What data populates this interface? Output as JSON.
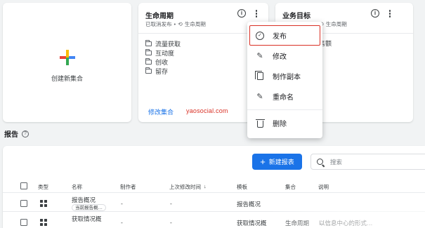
{
  "new_collection": {
    "label": "创建新集合"
  },
  "lifecycle_card": {
    "title": "生命周期",
    "status": "已取消发布",
    "separator": "•",
    "sync_label": "生命周期",
    "items": [
      "流量获取",
      "互动度",
      "创收",
      "留存"
    ],
    "edit_link": "修改集合"
  },
  "business_card": {
    "title": "业务目标",
    "sync_label": "生命周期",
    "visible_item": "售额"
  },
  "context_menu": {
    "items": [
      {
        "label": "发布",
        "icon": "check-circle-icon",
        "selected": true
      },
      {
        "label": "修改",
        "icon": "pencil-icon"
      },
      {
        "label": "制作副本",
        "icon": "copy-icon"
      },
      {
        "label": "重命名",
        "icon": "pencil-icon"
      },
      {
        "label": "删除",
        "icon": "trash-icon"
      }
    ]
  },
  "watermark": "yaosocial.com",
  "reports_section": {
    "title": "报告",
    "new_report_label": "新建报表",
    "search_placeholder": "搜索",
    "columns": {
      "type": "类型",
      "name": "名称",
      "creator": "制作者",
      "modified": "上次修改时间",
      "sort_arrow": "↓",
      "template": "模板",
      "collection": "集合",
      "description": "说明"
    },
    "rows": [
      {
        "name": "报告概况",
        "chip": "当前报告概…",
        "creator": "-",
        "modified": "-",
        "template": "报告概况",
        "collection": "",
        "description": ""
      },
      {
        "name": "获取情况概",
        "chip": "",
        "creator": "-",
        "modified": "-",
        "template": "获取情况概",
        "collection": "生命周期",
        "description": "以信息中心的形式…"
      }
    ]
  },
  "colors": {
    "accent": "#1a73e8",
    "highlight": "#d93025",
    "background": "#f1f3f4"
  }
}
